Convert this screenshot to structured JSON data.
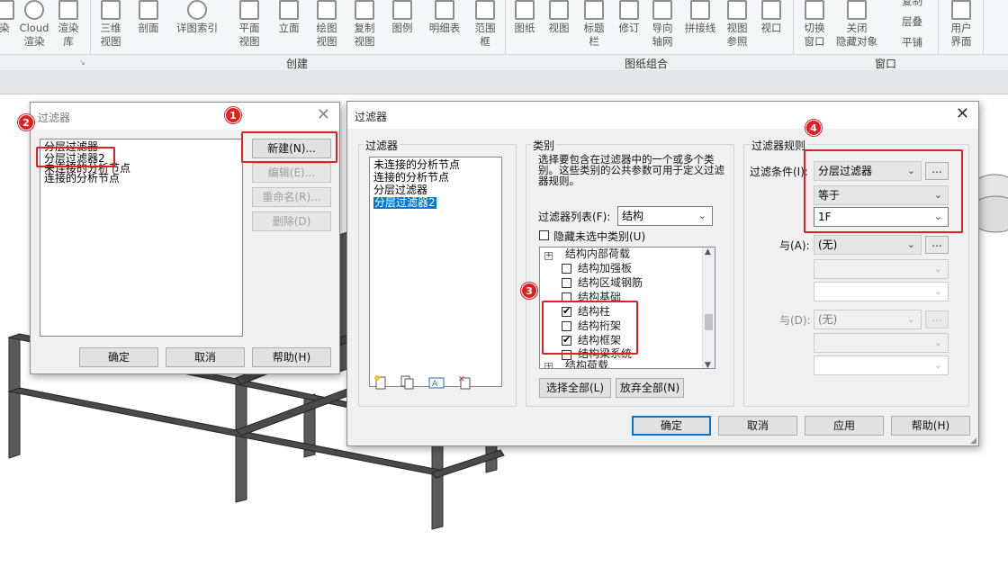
{
  "ribbon": {
    "buttons": [
      {
        "label": "染",
        "icon": "render-icon"
      },
      {
        "label": "Cloud\n渲染",
        "icon": "cloud-render-icon"
      },
      {
        "label": "渲染\n库",
        "icon": "render-gallery-icon"
      },
      {
        "label": "三维\n视图",
        "icon": "3d-view-icon"
      },
      {
        "label": "剖面",
        "icon": "section-icon"
      },
      {
        "label": "详图索引",
        "icon": "callout-icon"
      },
      {
        "label": "平面\n视图",
        "icon": "plan-view-icon"
      },
      {
        "label": "立面",
        "icon": "elevation-icon"
      },
      {
        "label": "绘图\n视图",
        "icon": "drafting-view-icon"
      },
      {
        "label": "复制\n视图",
        "icon": "duplicate-view-icon"
      },
      {
        "label": "图例",
        "icon": "legend-icon"
      },
      {
        "label": "明细表",
        "icon": "schedule-icon"
      },
      {
        "label": "范围\n框",
        "icon": "scope-box-icon"
      },
      {
        "label": "图纸",
        "icon": "sheet-icon"
      },
      {
        "label": "视图",
        "icon": "view-icon"
      },
      {
        "label": "标题\n栏",
        "icon": "title-block-icon"
      },
      {
        "label": "修订",
        "icon": "revisions-icon"
      },
      {
        "label": "导向\n轴网",
        "icon": "guide-grid-icon"
      },
      {
        "label": "拼接线",
        "icon": "matchline-icon"
      },
      {
        "label": "视图\n参照",
        "icon": "view-reference-icon"
      },
      {
        "label": "视口",
        "icon": "viewport-icon"
      },
      {
        "label": "切换\n窗口",
        "icon": "switch-window-icon"
      },
      {
        "label": "关闭\n隐藏对象",
        "icon": "close-hidden-icon"
      },
      {
        "label": "复制",
        "icon": "replicate-icon"
      },
      {
        "label": "层叠",
        "icon": "cascade-icon"
      },
      {
        "label": "平铺",
        "icon": "tile-icon"
      },
      {
        "label": "用户\n界面",
        "icon": "user-interface-icon"
      }
    ],
    "groups": {
      "create": "创建",
      "sheet_composition": "图纸组合",
      "windows": "窗口"
    }
  },
  "filters_dialog": {
    "title": "过滤器",
    "close": "✕",
    "items": [
      "分层过滤器",
      "分层过滤器2",
      "未连接的分析节点",
      "连接的分析节点"
    ],
    "new_button": "新建(N)...",
    "edit_button": "编辑(E)...",
    "rename_button": "重命名(R)...",
    "delete_button": "删除(D)",
    "ok": "确定",
    "cancel": "取消",
    "help": "帮助(H)"
  },
  "main_dialog": {
    "title": "过滤器",
    "close": "✕",
    "filters": {
      "label": "过滤器",
      "items": [
        "未连接的分析节点",
        "连接的分析节点",
        "分层过滤器",
        "分层过滤器2"
      ],
      "selected": "分层过滤器2",
      "toolbar_icons": [
        "new-filter-icon",
        "duplicate-filter-icon",
        "rename-filter-icon",
        "delete-filter-icon"
      ]
    },
    "categories": {
      "label": "类别",
      "description": "选择要包含在过滤器中的一个或多个类别。这些类别的公共参数可用于定义过滤器规则。",
      "filter_list_label": "过滤器列表(F):",
      "filter_list_value": "结构",
      "hide_unchecked_label": "隐藏未选中类别(U)",
      "hide_unchecked": false,
      "tree": [
        {
          "label": "结构内部荷载",
          "checked": null,
          "expander": true
        },
        {
          "label": "结构加强板",
          "checked": false
        },
        {
          "label": "结构区域钢筋",
          "checked": false
        },
        {
          "label": "结构基础",
          "checked": false
        },
        {
          "label": "结构柱",
          "checked": true
        },
        {
          "label": "结构桁架",
          "checked": false
        },
        {
          "label": "结构框架",
          "checked": true
        },
        {
          "label": "结构梁系统",
          "checked": false
        },
        {
          "label": "结构荷载",
          "checked": null,
          "expander": true
        }
      ],
      "select_all": "选择全部(L)",
      "deselect_all": "放弃全部(N)"
    },
    "rules": {
      "label": "过滤器规则",
      "condition_label": "过滤条件(I):",
      "condition_param": "分层过滤器",
      "condition_operator": "等于",
      "condition_value": "1F",
      "and1_label": "与(A):",
      "and1_value": "(无)",
      "and2_label": "与(D):",
      "and2_value": "(无)",
      "ellipsis": "..."
    },
    "ok": "确定",
    "cancel": "取消",
    "apply": "应用",
    "help": "帮助(H)"
  },
  "annotations": [
    "1",
    "2",
    "3",
    "4"
  ],
  "colors": {
    "highlight": "#e02020",
    "selection": "#0078d7",
    "beam": "#4a4a4a"
  }
}
